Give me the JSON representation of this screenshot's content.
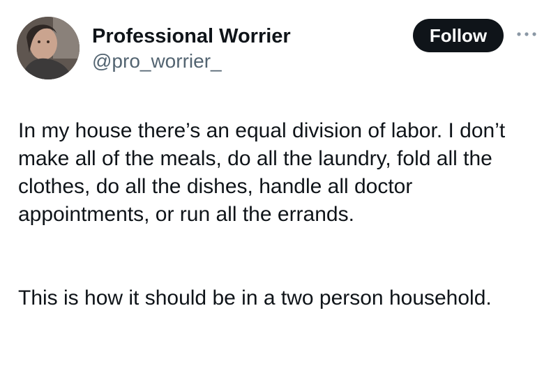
{
  "author": {
    "display_name": "Professional Worrier",
    "handle": "@pro_worrier_",
    "avatar_icon": "profile-photo"
  },
  "actions": {
    "follow_label": "Follow",
    "more_icon": "more-horizontal-icon"
  },
  "tweet": {
    "paragraph_1": "In my house there’s an equal division of labor. I don’t make all of the meals, do all the laundry, fold all the clothes, do all the dishes, handle all doctor appointments, or run all the errands.",
    "paragraph_2": "This is how it should be in a two person household."
  },
  "colors": {
    "text_primary": "#0f1419",
    "text_secondary": "#536471",
    "follow_button_bg": "#0f1419",
    "follow_button_text": "#ffffff"
  }
}
